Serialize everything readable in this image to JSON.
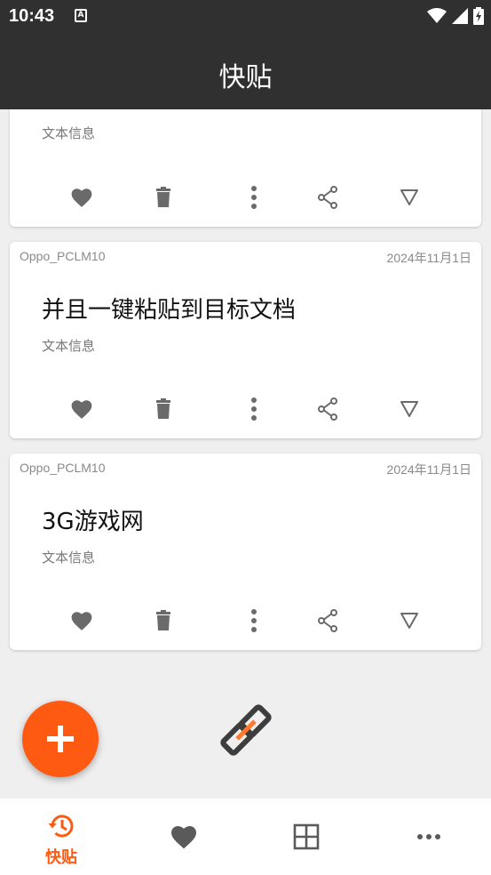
{
  "status_bar": {
    "time": "10:43",
    "notification_icon": "A"
  },
  "app_bar": {
    "title": "快贴"
  },
  "cards": [
    {
      "device": "",
      "date": "",
      "text": "",
      "type_label": "文本信息"
    },
    {
      "device": "Oppo_PCLM10",
      "date": "2024年11月1日",
      "text": "并且一键粘贴到目标文档",
      "type_label": "文本信息"
    },
    {
      "device": "Oppo_PCLM10",
      "date": "2024年11月1日",
      "text": "3G游戏网",
      "type_label": "文本信息"
    }
  ],
  "card_actions": [
    "heart-icon",
    "trash-icon",
    "more-vert-icon",
    "share-icon",
    "triangle-down-icon"
  ],
  "fab": {
    "icon": "plus-icon"
  },
  "bottom_nav": [
    {
      "icon": "history-icon",
      "label": "快贴",
      "active": true
    },
    {
      "icon": "heart-icon",
      "label": ""
    },
    {
      "icon": "grid-icon",
      "label": ""
    },
    {
      "icon": "more-horiz-icon",
      "label": ""
    }
  ],
  "colors": {
    "accent": "#ff5a12",
    "bar": "#303030",
    "icon_gray": "#6a6a6a"
  }
}
